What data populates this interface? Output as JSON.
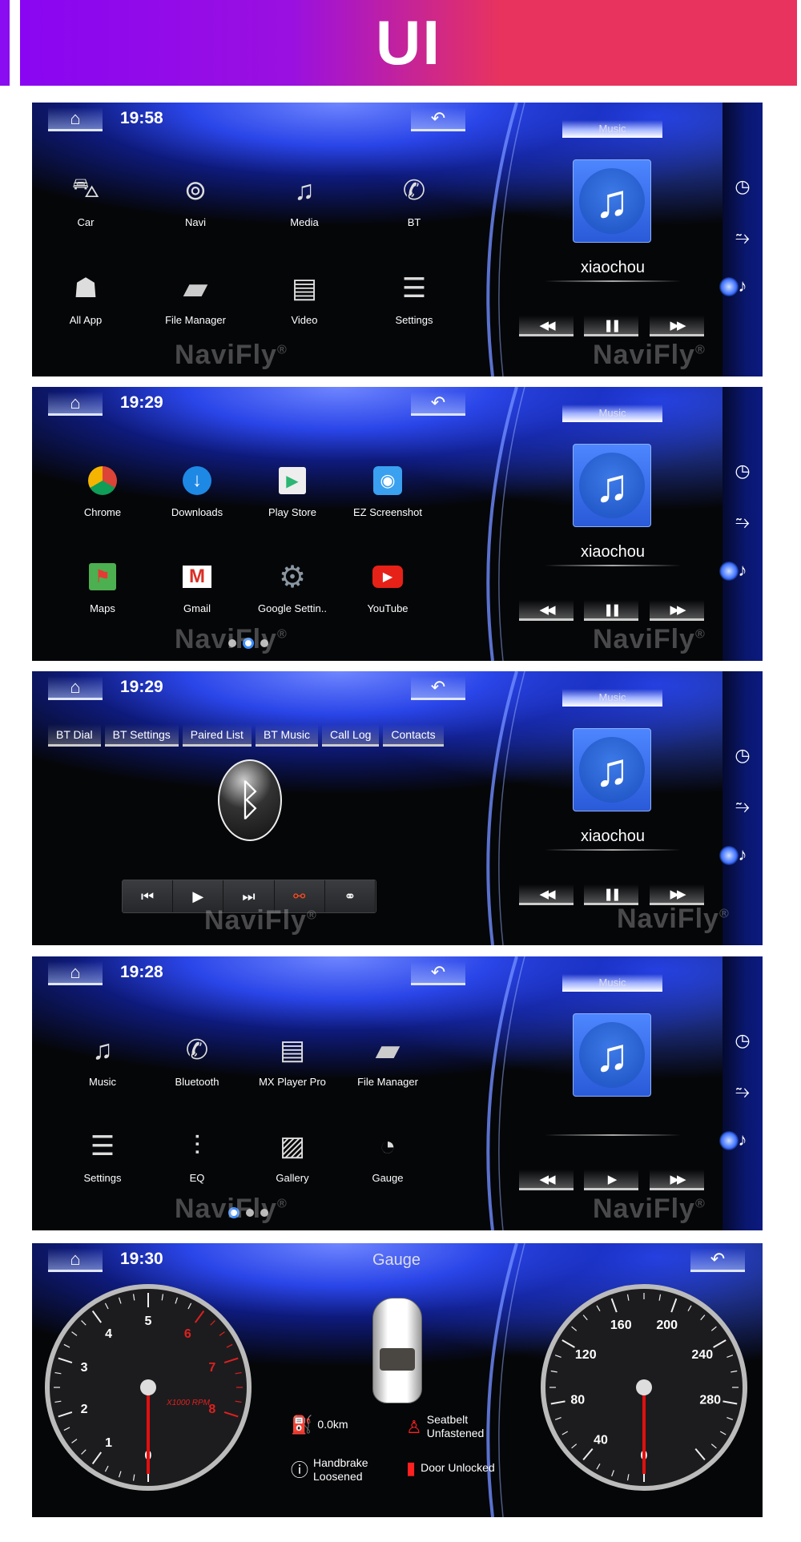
{
  "banner": {
    "title": "UI"
  },
  "colors": {
    "accent_blue": "#2a45e8",
    "banner_left": "#8a05f2",
    "banner_right": "#e8335e",
    "needle_red": "#e01010",
    "warning_red": "#ff2020"
  },
  "common": {
    "music_tab": "Music",
    "song": "xiaochou",
    "watermark": "NaviFly",
    "reg": "®",
    "home_icon": "home-icon",
    "back_icon": "back-arrow-icon"
  },
  "panels": [
    {
      "time": "19:58",
      "kind": "grid",
      "playing": true,
      "show_song": true,
      "apps": [
        {
          "label": "Car",
          "icon": "car-icon"
        },
        {
          "label": "Navi",
          "icon": "navi-icon"
        },
        {
          "label": "Media",
          "icon": "music-note-icon"
        },
        {
          "label": "BT",
          "icon": "phone-icon"
        },
        {
          "label": "All App",
          "icon": "android-icon"
        },
        {
          "label": "File Manager",
          "icon": "folder-icon"
        },
        {
          "label": "Video",
          "icon": "clapperboard-icon"
        },
        {
          "label": "Settings",
          "icon": "settings-doc-icon"
        }
      ]
    },
    {
      "time": "19:29",
      "kind": "grid2",
      "playing": true,
      "show_song": true,
      "page_dots": 3,
      "active_page": 1,
      "apps": [
        {
          "label": "Chrome",
          "icon": "chrome-icon"
        },
        {
          "label": "Downloads",
          "icon": "download-icon"
        },
        {
          "label": "Play Store",
          "icon": "play-store-icon"
        },
        {
          "label": "EZ Screenshot",
          "icon": "screenshot-icon"
        },
        {
          "label": "Maps",
          "icon": "maps-icon"
        },
        {
          "label": "Gmail",
          "icon": "gmail-icon"
        },
        {
          "label": "Google Settin..",
          "icon": "google-settings-icon"
        },
        {
          "label": "YouTube",
          "icon": "youtube-icon"
        }
      ]
    },
    {
      "time": "19:29",
      "kind": "bt",
      "playing": true,
      "show_song": true,
      "bt_tabs": [
        "BT Dial",
        "BT Settings",
        "Paired List",
        "BT Music",
        "Call Log",
        "Contacts"
      ],
      "bt_controls": [
        {
          "icon": "previous-icon"
        },
        {
          "icon": "play-icon"
        },
        {
          "icon": "next-icon"
        },
        {
          "icon": "disconnect-link-icon",
          "active": true
        },
        {
          "icon": "link-icon"
        }
      ]
    },
    {
      "time": "19:28",
      "kind": "grid2",
      "playing": false,
      "show_song": false,
      "page_dots": 3,
      "active_page": 0,
      "apps": [
        {
          "label": "Music",
          "icon": "music-note-icon"
        },
        {
          "label": "Bluetooth",
          "icon": "phone-icon"
        },
        {
          "label": "MX Player Pro",
          "icon": "clapperboard-icon"
        },
        {
          "label": "File Manager",
          "icon": "folder-icon"
        },
        {
          "label": "Settings",
          "icon": "settings-doc-icon"
        },
        {
          "label": "EQ",
          "icon": "equalizer-icon"
        },
        {
          "label": "Gallery",
          "icon": "gallery-icon"
        },
        {
          "label": "Gauge",
          "icon": "gauge-icon"
        }
      ]
    },
    {
      "time": "19:30",
      "kind": "gauge",
      "title": "Gauge",
      "tachometer": {
        "labels": [
          "0",
          "1",
          "2",
          "3",
          "4",
          "5",
          "6",
          "7",
          "8"
        ],
        "red_from": 6,
        "unit": "X1000 RPM",
        "value": 0
      },
      "speedometer": {
        "labels": [
          "0",
          "40",
          "80",
          "120",
          "160",
          "200",
          "240",
          "280"
        ],
        "value": 0
      },
      "status": {
        "range": "0.0km",
        "seatbelt": [
          "Seatbelt",
          "Unfastened"
        ],
        "handbrake": [
          "Handbrake",
          "Loosened"
        ],
        "door": "Door Unlocked"
      }
    }
  ]
}
